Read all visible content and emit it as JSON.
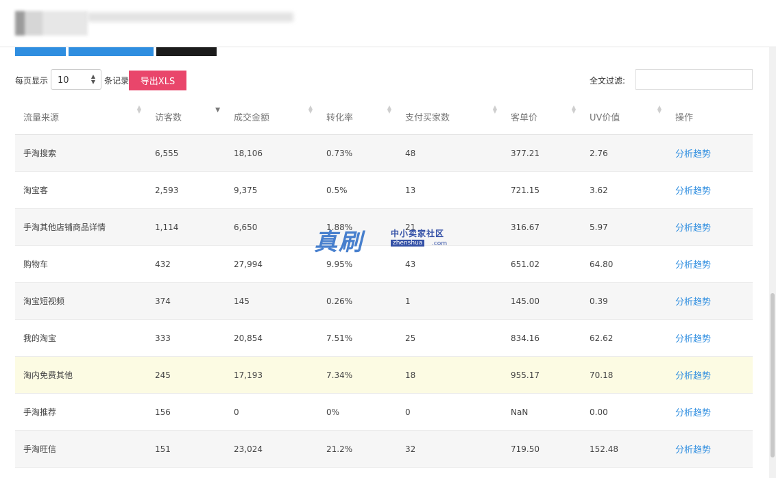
{
  "toolbar": {
    "page_size_prefix": "每页显示",
    "page_size_value": "10",
    "page_size_suffix": "条记录",
    "export_label": "导出XLS",
    "filter_label": "全文过滤:"
  },
  "table": {
    "columns": [
      "流量来源",
      "访客数",
      "成交金额",
      "转化率",
      "支付买家数",
      "客单价",
      "UV价值",
      "操作"
    ],
    "rows": [
      {
        "source": "手淘搜索",
        "visitors": "6,555",
        "amount": "18,106",
        "rate": "0.73%",
        "buyers": "48",
        "aov": "377.21",
        "uv": "2.76",
        "action": "分析趋势"
      },
      {
        "source": "淘宝客",
        "visitors": "2,593",
        "amount": "9,375",
        "rate": "0.5%",
        "buyers": "13",
        "aov": "721.15",
        "uv": "3.62",
        "action": "分析趋势"
      },
      {
        "source": "手淘其他店铺商品详情",
        "visitors": "1,114",
        "amount": "6,650",
        "rate": "1.88%",
        "buyers": "21",
        "aov": "316.67",
        "uv": "5.97",
        "action": "分析趋势"
      },
      {
        "source": "购物车",
        "visitors": "432",
        "amount": "27,994",
        "rate": "9.95%",
        "buyers": "43",
        "aov": "651.02",
        "uv": "64.80",
        "action": "分析趋势"
      },
      {
        "source": "淘宝短视频",
        "visitors": "374",
        "amount": "145",
        "rate": "0.26%",
        "buyers": "1",
        "aov": "145.00",
        "uv": "0.39",
        "action": "分析趋势"
      },
      {
        "source": "我的淘宝",
        "visitors": "333",
        "amount": "20,854",
        "rate": "7.51%",
        "buyers": "25",
        "aov": "834.16",
        "uv": "62.62",
        "action": "分析趋势"
      },
      {
        "source": "淘内免费其他",
        "visitors": "245",
        "amount": "17,193",
        "rate": "7.34%",
        "buyers": "18",
        "aov": "955.17",
        "uv": "70.18",
        "action": "分析趋势"
      },
      {
        "source": "手淘推荐",
        "visitors": "156",
        "amount": "0",
        "rate": "0%",
        "buyers": "0",
        "aov": "NaN",
        "uv": "0.00",
        "action": "分析趋势"
      },
      {
        "source": "手淘旺信",
        "visitors": "151",
        "amount": "23,024",
        "rate": "21.2%",
        "buyers": "32",
        "aov": "719.50",
        "uv": "152.48",
        "action": "分析趋势"
      }
    ]
  },
  "watermark": {
    "big": "真刷",
    "cn": "中小卖家社区",
    "en": "zhenshua",
    "com": ".com"
  }
}
